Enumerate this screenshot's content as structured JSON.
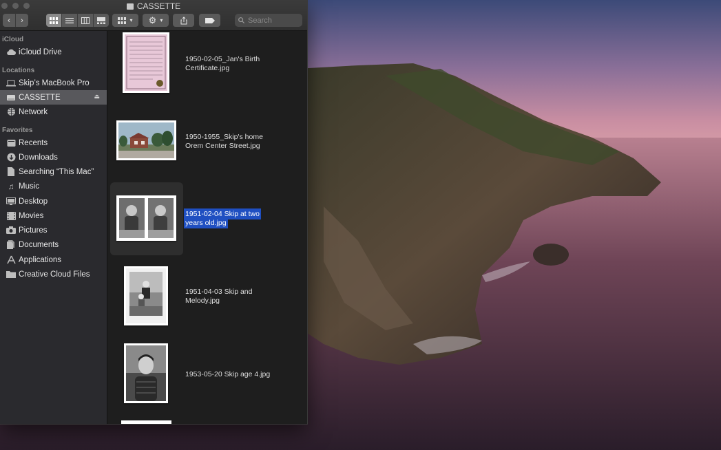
{
  "window": {
    "title": "CASSETTE",
    "search_placeholder": "Search"
  },
  "toolbar": {
    "back_icon": "chevron-left-icon",
    "forward_icon": "chevron-right-icon",
    "view_modes": [
      "icon-view-icon",
      "list-view-icon",
      "column-view-icon",
      "gallery-view-icon"
    ],
    "active_view": "icon-view-icon"
  },
  "sidebar": {
    "sections": [
      {
        "label": "iCloud",
        "items": [
          {
            "label": "iCloud Drive",
            "icon": "cloud-icon"
          }
        ]
      },
      {
        "label": "Locations",
        "items": [
          {
            "label": "Skip’s MacBook Pro",
            "icon": "laptop-icon"
          },
          {
            "label": "CASSETTE",
            "icon": "drive-icon",
            "selected": true,
            "eject": true
          },
          {
            "label": "Network",
            "icon": "globe-icon"
          }
        ]
      },
      {
        "label": "Favorites",
        "items": [
          {
            "label": "Recents",
            "icon": "recents-icon"
          },
          {
            "label": "Downloads",
            "icon": "download-icon"
          },
          {
            "label": "Searching “This Mac”",
            "icon": "document-icon"
          },
          {
            "label": "Music",
            "icon": "music-icon"
          },
          {
            "label": "Desktop",
            "icon": "desktop-icon"
          },
          {
            "label": "Movies",
            "icon": "film-icon"
          },
          {
            "label": "Pictures",
            "icon": "camera-icon"
          },
          {
            "label": "Documents",
            "icon": "documents-icon"
          },
          {
            "label": "Applications",
            "icon": "applications-icon"
          },
          {
            "label": "Creative Cloud Files",
            "icon": "folder-icon"
          }
        ]
      }
    ]
  },
  "files": [
    {
      "line1": "1950-02-05_Jan's Birth",
      "line2": "Certificate.jpg",
      "selected": false
    },
    {
      "line1": "1950-1955_Skip's home",
      "line2": "Orem Center Street.jpg",
      "selected": false
    },
    {
      "line1": "1951-02-04 Skip at two",
      "line2": "years old.jpg",
      "selected": true
    },
    {
      "line1": "1951-04-03 Skip and",
      "line2": "Melody.jpg",
      "selected": false
    },
    {
      "line1": "1953-05-20 Skip age 4.jpg",
      "line2": "",
      "selected": false
    }
  ]
}
